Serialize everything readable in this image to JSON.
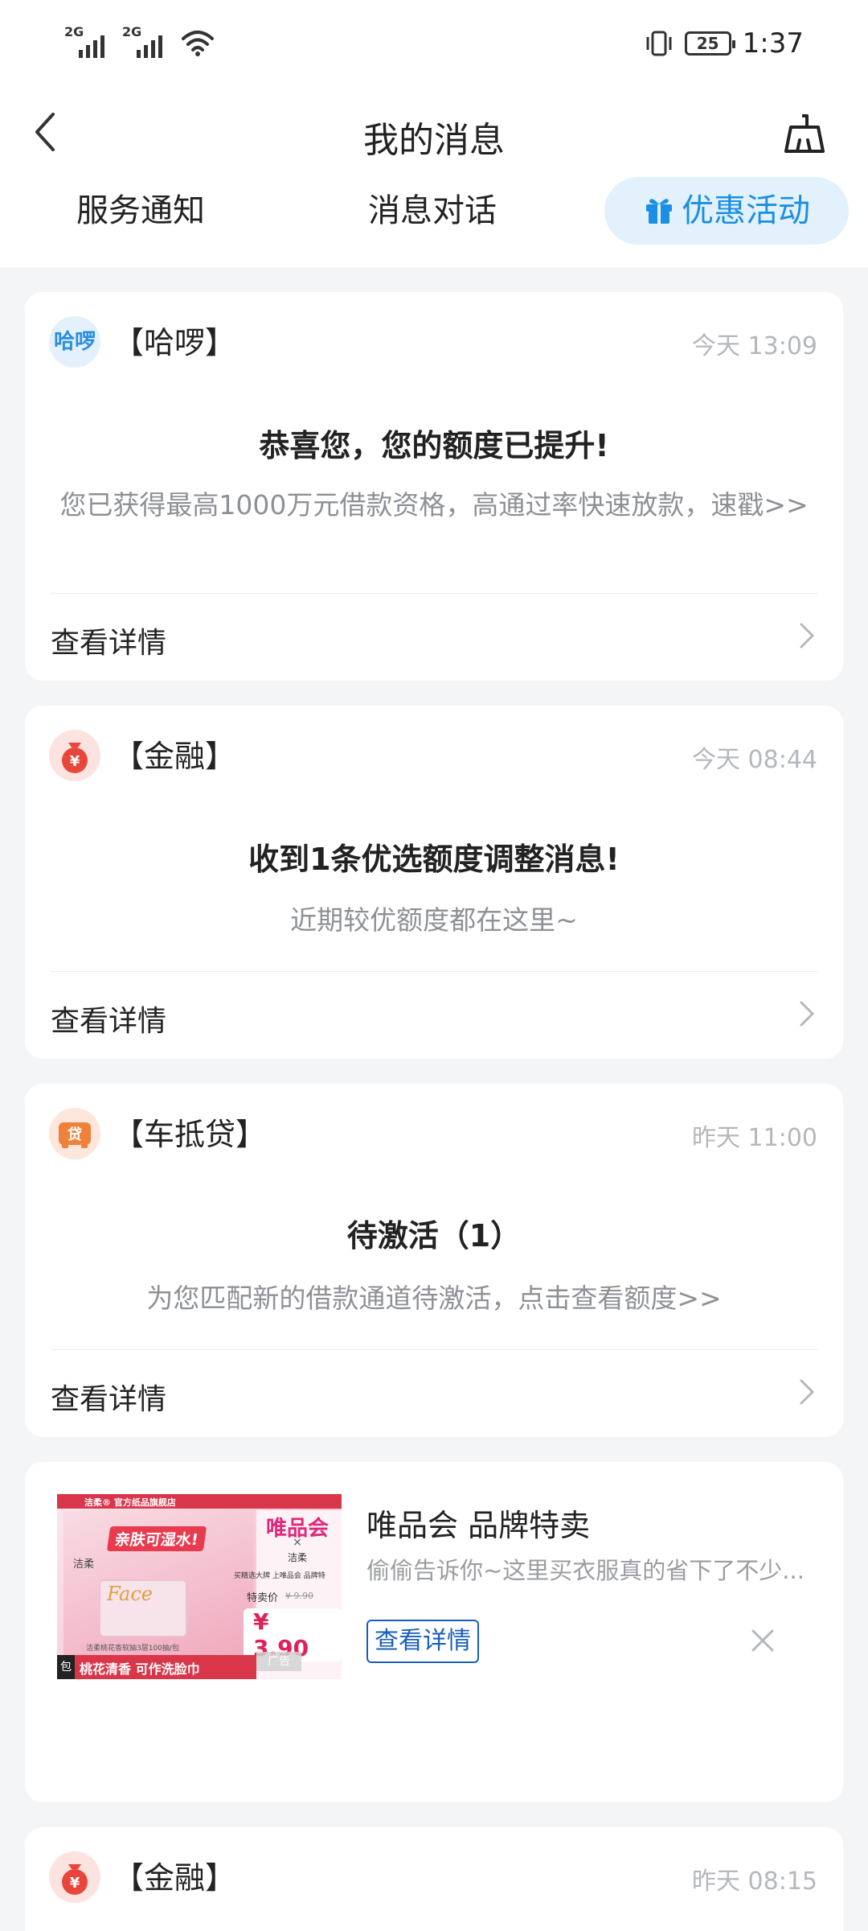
{
  "status_bar": {
    "sim1": "2G",
    "sim2": "2G",
    "battery": "25",
    "time": "1:37"
  },
  "header": {
    "title": "我的消息"
  },
  "tabs": [
    {
      "label": "服务通知"
    },
    {
      "label": "消息对话"
    },
    {
      "label": "优惠活动",
      "active": true
    }
  ],
  "messages": [
    {
      "icon_text": "哈啰",
      "source": "【哈啰】",
      "time": "今天 13:09",
      "headline": "恭喜您，您的额度已提升!",
      "desc": "您已获得最高1000万元借款资格，高通过率快速放款，速戳>>",
      "detail": "查看详情"
    },
    {
      "icon_text": "¥",
      "source": "【金融】",
      "time": "今天 08:44",
      "headline": "收到1条优选额度调整消息!",
      "desc": "近期较优额度都在这里~",
      "detail": "查看详情"
    },
    {
      "icon_text": "贷",
      "source": "【车抵贷】",
      "time": "昨天 11:00",
      "headline": "待激活（1）",
      "desc": "为您匹配新的借款通道待激活，点击查看额度>>",
      "detail": "查看详情"
    },
    {
      "icon_text": "¥",
      "source": "【金融】",
      "time": "昨天 08:15"
    }
  ],
  "ad": {
    "title": "唯品会 品牌特卖",
    "subtitle": "偷偷告诉你~这里买衣服真的省下了不少...",
    "button": "查看详情",
    "image": {
      "store": "洁柔® 官方纸品旗舰店",
      "slogan": "亲肤可湿水!",
      "brand": "洁柔",
      "product": "Face",
      "vip_logo": "唯品会",
      "cross": "×",
      "jierou": "洁柔",
      "promo": "买精选大牌 上唯品会 品牌特",
      "special_label": "特卖价",
      "old_price": "¥ 9.90",
      "price": "¥ 3.90",
      "ad_badge": "广告",
      "small_print": "洁柔桃花香软抽3层100抽/包",
      "bottom": "桃花清香 可作洗脸巾",
      "pack": "包"
    }
  },
  "colors": {
    "accent": "#1a8fe3",
    "tab_active_bg": "#e3f1fc",
    "card_bg": "#ffffff",
    "page_bg": "#f4f5f7",
    "time_grey": "#b4b7bc",
    "desc_grey": "#8d9095",
    "finance_red": "#e8463a",
    "car_orange": "#f0813a",
    "ad_button": "#1a5fb8"
  }
}
